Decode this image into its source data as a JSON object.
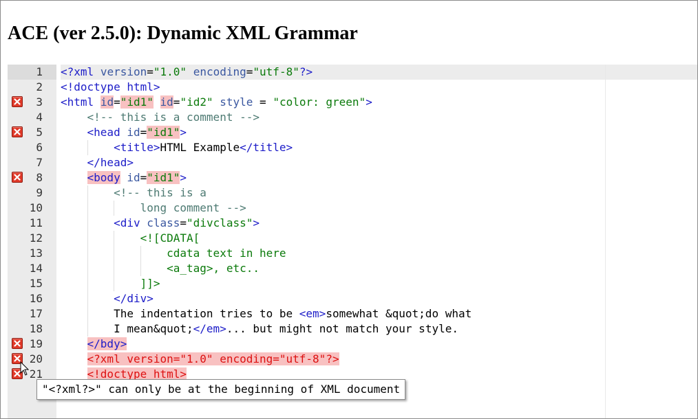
{
  "page": {
    "title": "ACE (ver 2.5.0): Dynamic XML Grammar"
  },
  "editor": {
    "gutter_lines": [
      "1",
      "2",
      "3",
      "4",
      "5",
      "6",
      "7",
      "8",
      "9",
      "10",
      "11",
      "12",
      "13",
      "14",
      "15",
      "16",
      "17",
      "18",
      "19",
      "20",
      "21",
      "2"
    ],
    "error_lines": [
      3,
      5,
      8,
      19,
      20,
      21
    ],
    "lines": [
      [
        {
          "t": "<?xml",
          "c": "tag"
        },
        {
          "t": " ",
          "c": "text"
        },
        {
          "t": "version",
          "c": "attr"
        },
        {
          "t": "=",
          "c": "eq"
        },
        {
          "t": "\"1.0\"",
          "c": "str"
        },
        {
          "t": " ",
          "c": "text"
        },
        {
          "t": "encoding",
          "c": "attr"
        },
        {
          "t": "=",
          "c": "eq"
        },
        {
          "t": "\"utf-8\"",
          "c": "str"
        },
        {
          "t": "?>",
          "c": "tag"
        }
      ],
      [
        {
          "t": "<!doctype html>",
          "c": "tag"
        }
      ],
      [
        {
          "t": "<html",
          "c": "tag"
        },
        {
          "t": " ",
          "c": "text"
        },
        {
          "t": "id",
          "c": "attr",
          "hl": true
        },
        {
          "t": "=",
          "c": "eq"
        },
        {
          "t": "\"id1\"",
          "c": "str",
          "hl": true
        },
        {
          "t": " ",
          "c": "text"
        },
        {
          "t": "id",
          "c": "attr",
          "hl": true
        },
        {
          "t": "=",
          "c": "eq"
        },
        {
          "t": "\"id2\"",
          "c": "str"
        },
        {
          "t": " ",
          "c": "text"
        },
        {
          "t": "style",
          "c": "attr"
        },
        {
          "t": " = ",
          "c": "eq"
        },
        {
          "t": "\"color: green\"",
          "c": "str"
        },
        {
          "t": ">",
          "c": "tag"
        }
      ],
      [
        {
          "t": "    ",
          "c": "text"
        },
        {
          "t": "<!-- this is a comment -->",
          "c": "com"
        }
      ],
      [
        {
          "t": "    ",
          "c": "text"
        },
        {
          "t": "<head",
          "c": "tag"
        },
        {
          "t": " ",
          "c": "text"
        },
        {
          "t": "id",
          "c": "attr"
        },
        {
          "t": "=",
          "c": "eq"
        },
        {
          "t": "\"id1\"",
          "c": "str",
          "hl": true
        },
        {
          "t": ">",
          "c": "tag"
        }
      ],
      [
        {
          "t": "        ",
          "c": "text"
        },
        {
          "t": "<title>",
          "c": "tag"
        },
        {
          "t": "HTML Example",
          "c": "text"
        },
        {
          "t": "</title>",
          "c": "tag"
        }
      ],
      [
        {
          "t": "    ",
          "c": "text"
        },
        {
          "t": "</head>",
          "c": "tag"
        }
      ],
      [
        {
          "t": "    ",
          "c": "text"
        },
        {
          "t": "<body",
          "c": "tag",
          "hl": true
        },
        {
          "t": " ",
          "c": "text"
        },
        {
          "t": "id",
          "c": "attr"
        },
        {
          "t": "=",
          "c": "eq"
        },
        {
          "t": "\"id1\"",
          "c": "str",
          "hl": true
        },
        {
          "t": ">",
          "c": "tag"
        }
      ],
      [
        {
          "t": "        ",
          "c": "text"
        },
        {
          "t": "<!-- this is a",
          "c": "com"
        }
      ],
      [
        {
          "t": "            ",
          "c": "text"
        },
        {
          "t": "long comment -->",
          "c": "com"
        }
      ],
      [
        {
          "t": "        ",
          "c": "text"
        },
        {
          "t": "<div",
          "c": "tag"
        },
        {
          "t": " ",
          "c": "text"
        },
        {
          "t": "class",
          "c": "attr"
        },
        {
          "t": "=",
          "c": "eq"
        },
        {
          "t": "\"divclass\"",
          "c": "str"
        },
        {
          "t": ">",
          "c": "tag"
        }
      ],
      [
        {
          "t": "            ",
          "c": "text"
        },
        {
          "t": "<![CDATA[",
          "c": "cdata"
        }
      ],
      [
        {
          "t": "                ",
          "c": "text"
        },
        {
          "t": "cdata text in here",
          "c": "cdata"
        }
      ],
      [
        {
          "t": "                ",
          "c": "text"
        },
        {
          "t": "<a_tag>, etc..",
          "c": "cdata"
        }
      ],
      [
        {
          "t": "            ",
          "c": "text"
        },
        {
          "t": "]]>",
          "c": "cdata"
        }
      ],
      [
        {
          "t": "        ",
          "c": "text"
        },
        {
          "t": "</div>",
          "c": "tag"
        }
      ],
      [
        {
          "t": "        ",
          "c": "text"
        },
        {
          "t": "The indentation tries to be ",
          "c": "text"
        },
        {
          "t": "<em>",
          "c": "tag"
        },
        {
          "t": "somewhat &quot;do what",
          "c": "text"
        }
      ],
      [
        {
          "t": "        ",
          "c": "text"
        },
        {
          "t": "I mean&quot;",
          "c": "text"
        },
        {
          "t": "</em>",
          "c": "tag"
        },
        {
          "t": "... but might not match your style.",
          "c": "text"
        }
      ],
      [
        {
          "t": "    ",
          "c": "text"
        },
        {
          "t": "</bdy>",
          "c": "tag",
          "hl": true
        }
      ],
      [
        {
          "t": "    ",
          "c": "text"
        },
        {
          "t": "<?xml version=\"1.0\" encoding=\"utf-8\"?>",
          "c": "inv",
          "hl": true
        }
      ],
      [
        {
          "t": "    ",
          "c": "text"
        },
        {
          "t": "<!doctype html>",
          "c": "inv",
          "hl": true
        }
      ],
      [
        {
          "t": "",
          "c": "text"
        }
      ]
    ]
  },
  "tooltip": {
    "text": "\"<?xml?>\" can only be at the beginning of XML document"
  },
  "colors": {
    "error_bg": "#f8c1c1",
    "error_icon": "#e03a2a",
    "tag": "#1c1cc8",
    "attr": "#3a57a0",
    "string": "#0b7a0b",
    "comment": "#4d7a72"
  }
}
